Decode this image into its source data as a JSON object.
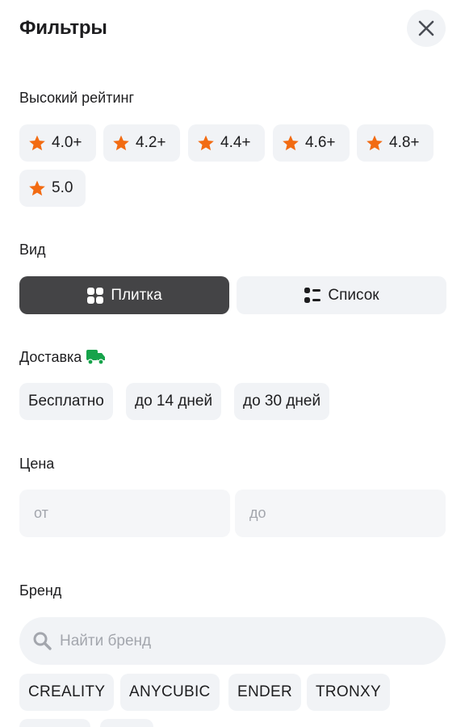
{
  "header": {
    "title": "Фильтры",
    "close_icon": "close-icon"
  },
  "rating": {
    "title": "Высокий рейтинг",
    "star_color": "#f26b12",
    "options": [
      "4.0+",
      "4.2+",
      "4.4+",
      "4.6+",
      "4.8+",
      "5.0"
    ]
  },
  "view": {
    "title": "Вид",
    "options": [
      {
        "label": "Плитка",
        "icon": "grid-icon",
        "selected": true
      },
      {
        "label": "Список",
        "icon": "list-icon",
        "selected": false
      }
    ]
  },
  "delivery": {
    "title": "Доставка",
    "icon": "delivery-truck-icon",
    "icon_color": "#16a34a",
    "options": [
      "Бесплатно",
      "до 14 дней",
      "до 30 дней"
    ]
  },
  "price": {
    "title": "Цена",
    "from_placeholder": "от",
    "to_placeholder": "до"
  },
  "brand": {
    "title": "Бренд",
    "search_placeholder": "Найти бренд",
    "options": [
      "CREALITY",
      "ANYCUBIC",
      "ENDER",
      "TRONXY"
    ]
  }
}
